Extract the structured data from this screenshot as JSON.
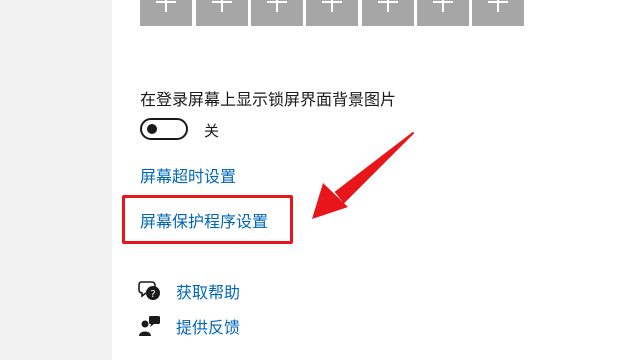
{
  "lock_screen": {
    "show_background_label": "在登录屏幕上显示锁屏界面背景图片",
    "toggle_state": "关",
    "toggle_on": false
  },
  "links": {
    "screen_timeout": "屏幕超时设置",
    "screen_saver": "屏幕保护程序设置"
  },
  "help": {
    "get_help": "获取帮助",
    "give_feedback": "提供反馈"
  },
  "colors": {
    "link": "#0067b8",
    "annotation": "#e8161b",
    "tile": "#a6a6a6"
  },
  "icons": {
    "app_tile": "plus-icon",
    "get_help": "chat-help-icon",
    "feedback": "feedback-person-icon"
  }
}
